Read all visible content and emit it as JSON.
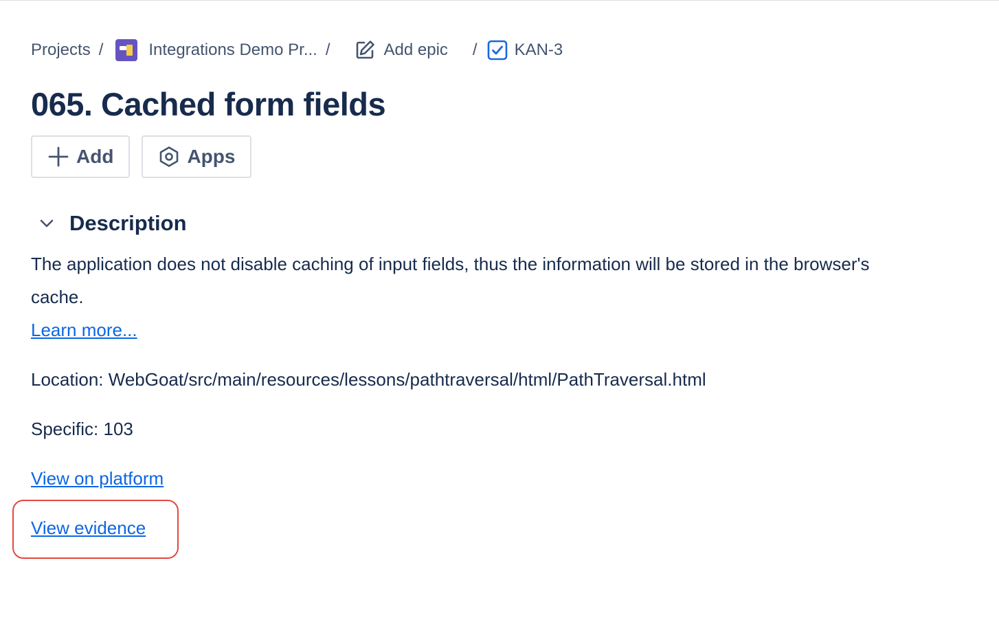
{
  "breadcrumb": {
    "projects": "Projects",
    "separator": "/",
    "project_name": "Integrations Demo Pr...",
    "add_epic": "Add epic",
    "issue_key": "KAN-3"
  },
  "issue": {
    "title": "065. Cached form fields"
  },
  "actions": {
    "add_label": "Add",
    "apps_label": "Apps"
  },
  "description": {
    "heading": "Description",
    "text": "The application does not disable caching of input fields, thus the information will be stored in the browser's cache.",
    "learn_more": "Learn more...",
    "location": "Location: WebGoat/src/main/resources/lessons/pathtraversal/html/PathTraversal.html",
    "specific": "Specific: 103",
    "view_on_platform": "View on platform",
    "view_evidence": "View evidence"
  },
  "colors": {
    "link": "#0c66e4",
    "highlight_border": "#e2483d",
    "project_avatar": "#6554c0",
    "issue_check": "#1868db"
  },
  "icons": [
    "project-avatar-icon",
    "edit-icon",
    "checkbox-icon",
    "plus-icon",
    "hexagon-icon",
    "chevron-down-icon"
  ]
}
